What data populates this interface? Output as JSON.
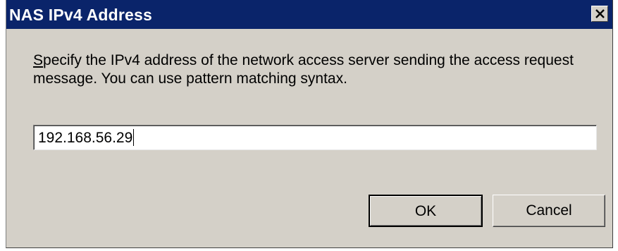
{
  "window": {
    "title": "NAS IPv4 Address",
    "close_icon": "close-icon"
  },
  "prompt": {
    "mnemonic_letter": "S",
    "rest": "pecify the IPv4 address of the network access server sending the access request message.  You can use pattern matching syntax."
  },
  "address_field": {
    "value": "192.168.56.29"
  },
  "buttons": {
    "ok_label": "OK",
    "cancel_label": "Cancel"
  },
  "colors": {
    "titlebar": "#0a246a",
    "dialog_background": "#d4d0c8"
  }
}
